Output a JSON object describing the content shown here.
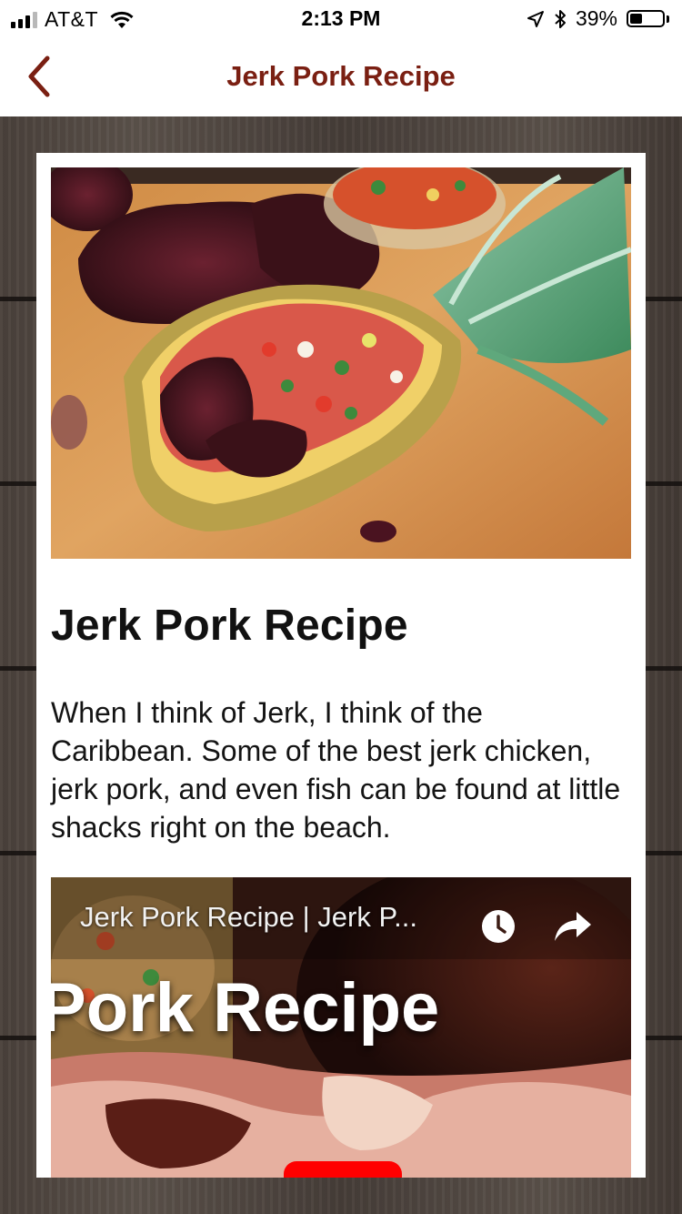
{
  "status_bar": {
    "carrier": "AT&T",
    "time": "2:13 PM",
    "battery_percent": "39%",
    "battery_level": 0.39,
    "signal_bars_filled": 3,
    "signal_bars_total": 4
  },
  "nav": {
    "title": "Jerk Pork Recipe",
    "back_icon": "chevron-left-icon",
    "accent_color": "#7a1f12"
  },
  "article": {
    "hero_image_alt": "jerk pork in pineapple boat with salsa",
    "title": "Jerk Pork Recipe",
    "description": "When I think of Jerk, I think of the Caribbean. Some of the best jerk chicken, jerk pork, and even fish can be found at little shacks right on the beach."
  },
  "video": {
    "title": "Jerk Pork Recipe | Jerk P...",
    "overlay_text": "Pork Recipe",
    "watch_later_icon": "clock-icon",
    "share_icon": "share-icon",
    "play_color": "#ff0000"
  }
}
